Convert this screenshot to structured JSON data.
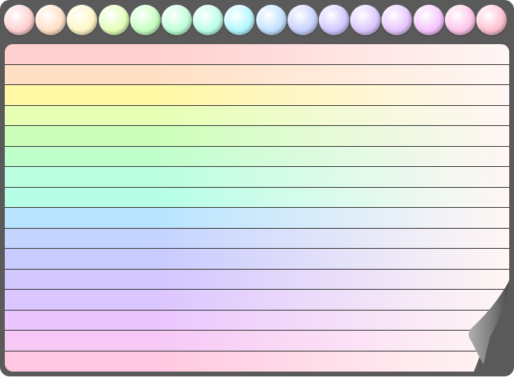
{
  "circle_colors": [
    "#ffd0d0",
    "#ffe0c8",
    "#fff6c6",
    "#e2ffb8",
    "#c6ffc0",
    "#c0ffd8",
    "#bcffea",
    "#b4f8ff",
    "#c2e2ff",
    "#c8d2ff",
    "#d0c8ff",
    "#dcc8ff",
    "#e8c6ff",
    "#f6c6ff",
    "#ffc6ec",
    "#ffc2d2"
  ],
  "row_colors": [
    "#ffd0d0",
    "#ffe0c4",
    "#fff8a4",
    "#e6ffb4",
    "#ccffba",
    "#c0ffcc",
    "#baffe0",
    "#b6ffe6",
    "#b8e4ff",
    "#c4d4ff",
    "#c8cbff",
    "#d2c6ff",
    "#dcc6ff",
    "#eac6ff",
    "#f6c8f6",
    "#ffc8e0"
  ],
  "frame_color": "#5a5a5a",
  "curl_color": "#8a8a8a"
}
